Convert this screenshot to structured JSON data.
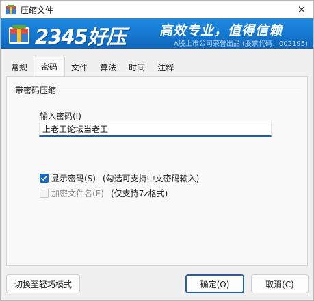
{
  "window": {
    "title": "压缩文件",
    "close_glyph": "✕"
  },
  "banner": {
    "brand": "2345好压",
    "slogan": "高效专业，值得信赖",
    "tagline": "A股上市公司荣誉出品 (股票代码：002195)"
  },
  "tabs": [
    {
      "label": "常规"
    },
    {
      "label": "密码"
    },
    {
      "label": "文件"
    },
    {
      "label": "算法"
    },
    {
      "label": "时间"
    },
    {
      "label": "注释"
    }
  ],
  "active_tab": "密码",
  "password_group": {
    "title": "带密码压缩",
    "input_label": "输入密码(I)",
    "password_value": "上老王论坛当老王",
    "show_password": {
      "label": "显示密码(S)",
      "note": "(勾选可支持中文密码输入)",
      "checked": true
    },
    "encrypt_filenames": {
      "label": "加密文件名(E)",
      "note": "(仅支持7z格式)",
      "checked": false,
      "disabled": true
    }
  },
  "buttons": {
    "switch_mode": "切换至轻巧模式",
    "ok": "确定(O)",
    "cancel": "取消(C)"
  },
  "colors": {
    "banner_blue": "#1577cf",
    "accent": "#1f5fa8",
    "checkbox_blue": "#1667c2"
  },
  "icons": {
    "app": "archive-box-icon",
    "close": "close-icon",
    "check": "checkmark-icon"
  }
}
